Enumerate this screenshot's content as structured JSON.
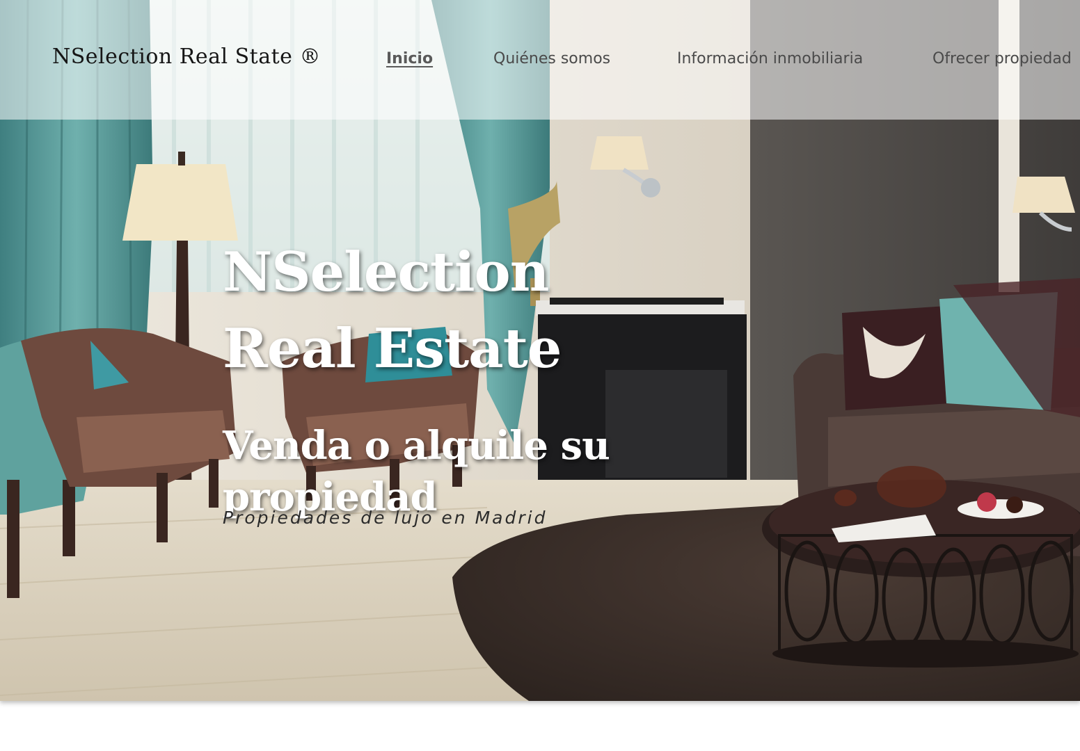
{
  "header": {
    "logo": "NSelection Real State ®",
    "nav": [
      {
        "label": "Inicio",
        "active": true
      },
      {
        "label": "Quiénes somos",
        "active": false
      },
      {
        "label": "Información inmobiliaria",
        "active": false
      },
      {
        "label": "Ofrecer propiedad",
        "active": false
      }
    ]
  },
  "hero": {
    "title": "NSelection\nReal Estate",
    "subtitle": "Venda o alquile su propiedad",
    "tagline": "Propiedades de lujo en Madrid",
    "background": "living-room-photo"
  },
  "colors": {
    "header_bg": "#ffffffcc",
    "hero_text": "#ffffff",
    "nav_text": "#4a4a4a",
    "curtain": "#5a9a98",
    "wall": "#d8d2c6",
    "dark_wall": "#4a4744",
    "floor": "#d9cfbd",
    "rug": "#3a2e29",
    "sofa": "#4a3a36"
  }
}
